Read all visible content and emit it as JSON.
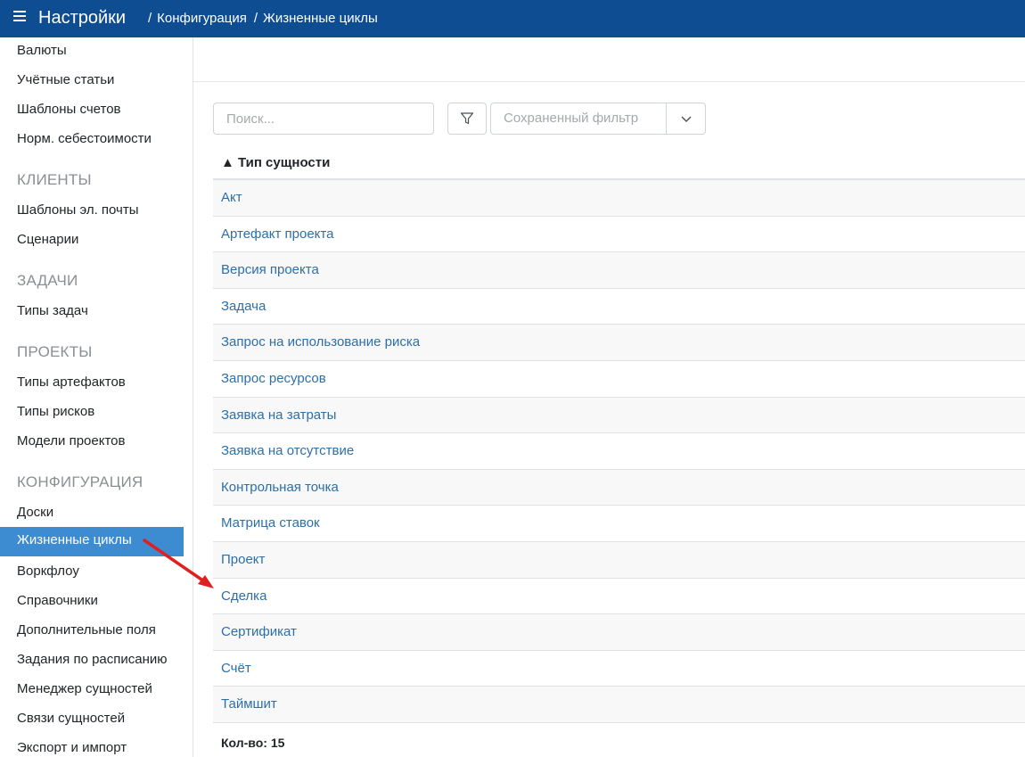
{
  "header": {
    "app_title": "Настройки",
    "breadcrumb": [
      "Конфигурация",
      "Жизненные циклы"
    ],
    "background": "#0e4d92"
  },
  "sidebar": {
    "items": [
      {
        "type": "item",
        "label": "Валюты"
      },
      {
        "type": "item",
        "label": "Учётные статьи"
      },
      {
        "type": "item",
        "label": "Шаблоны счетов"
      },
      {
        "type": "item",
        "label": "Норм. себестоимости"
      },
      {
        "type": "heading",
        "label": "КЛИЕНТЫ"
      },
      {
        "type": "item",
        "label": "Шаблоны эл. почты"
      },
      {
        "type": "item",
        "label": "Сценарии"
      },
      {
        "type": "heading",
        "label": "ЗАДАЧИ"
      },
      {
        "type": "item",
        "label": "Типы задач"
      },
      {
        "type": "heading",
        "label": "ПРОЕКТЫ"
      },
      {
        "type": "item",
        "label": "Типы артефактов"
      },
      {
        "type": "item",
        "label": "Типы рисков"
      },
      {
        "type": "item",
        "label": "Модели проектов"
      },
      {
        "type": "heading",
        "label": "КОНФИГУРАЦИЯ"
      },
      {
        "type": "item",
        "label": "Доски"
      },
      {
        "type": "item",
        "label": "Жизненные циклы",
        "active": true
      },
      {
        "type": "item",
        "label": "Воркфлоу"
      },
      {
        "type": "item",
        "label": "Справочники"
      },
      {
        "type": "item",
        "label": "Дополнительные поля"
      },
      {
        "type": "item",
        "label": "Задания по расписанию"
      },
      {
        "type": "item",
        "label": "Менеджер сущностей"
      },
      {
        "type": "item",
        "label": "Связи сущностей"
      },
      {
        "type": "item",
        "label": "Экспорт и импорт"
      }
    ],
    "active_color": "#3d8bd0"
  },
  "toolbar": {
    "search_placeholder": "Поиск...",
    "saved_filter_placeholder": "Сохраненный фильтр"
  },
  "table": {
    "column_header": "▲ Тип сущности",
    "rows": [
      "Акт",
      "Артефакт проекта",
      "Версия проекта",
      "Задача",
      "Запрос на использование риска",
      "Запрос ресурсов",
      "Заявка на затраты",
      "Заявка на отсутствие",
      "Контрольная точка",
      "Матрица ставок",
      "Проект",
      "Сделка",
      "Сертификат",
      "Счёт",
      "Таймшит"
    ],
    "link_color": "#2d6fa8"
  },
  "footer": {
    "count_label": "Кол-во: 15"
  },
  "annotation": {
    "arrow_color": "#e02020"
  }
}
